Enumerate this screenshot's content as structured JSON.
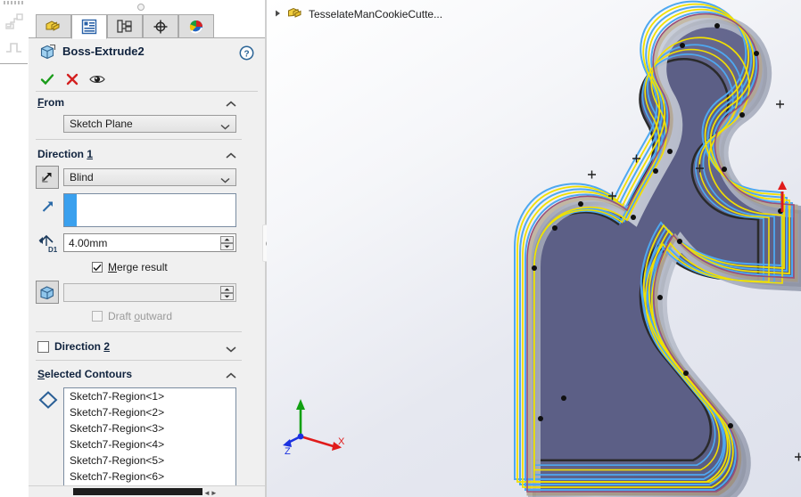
{
  "app": {
    "document_tab": "TesselateManCookieCutte...",
    "doc_icon": "part-document-icon"
  },
  "tabs": [
    {
      "name": "feature-manager-design-tree",
      "icon": "feature-tree-icon",
      "active": false
    },
    {
      "name": "property-manager",
      "icon": "property-list-icon",
      "active": true
    },
    {
      "name": "configuration-manager",
      "icon": "configuration-icon",
      "active": false
    },
    {
      "name": "dimxpert-manager",
      "icon": "dimxpert-target-icon",
      "active": false
    },
    {
      "name": "display-manager",
      "icon": "display-appearance-icon",
      "active": false
    }
  ],
  "property_manager": {
    "title": "Boss-Extrude2",
    "title_icon": "boss-extrude-icon",
    "help_label": "?",
    "actions": [
      {
        "name": "ok-button",
        "icon": "green-check-icon",
        "label": "✔"
      },
      {
        "name": "cancel-button",
        "icon": "red-x-icon",
        "label": "✖"
      },
      {
        "name": "detailed-preview-button",
        "icon": "eye-icon",
        "label": "◉"
      }
    ],
    "sections": {
      "from": {
        "header": "From",
        "header_mnemonic": "F",
        "start_condition": "Sketch Plane"
      },
      "direction1": {
        "header": "Direction ",
        "header_mnemonic": "1",
        "reverse_direction_icon": "reverse-direction-icon",
        "end_condition": "Blind",
        "direction_reference_icon": "direction-arrow-icon",
        "direction_reference_value": "",
        "depth_icon": "depth-dimension-icon",
        "depth_value": "4.00mm",
        "merge_result_label": "Merge result",
        "merge_result_mnemonic": "M",
        "merge_result_checked": true,
        "draft_icon": "draft-angle-icon",
        "draft_value": "",
        "draft_enabled": false,
        "draft_outward_label": "Draft outward",
        "draft_outward_mnemonic": "o",
        "draft_outward_checked": false
      },
      "direction2": {
        "header": "Direction ",
        "header_mnemonic": "2",
        "enabled": false,
        "expanded": false
      },
      "selected_contours": {
        "header": "Selected Contours",
        "header_mnemonic": "S",
        "icon": "contour-diamond-icon",
        "items": [
          "Sketch7-Region<1>",
          "Sketch7-Region<2>",
          "Sketch7-Region<3>",
          "Sketch7-Region<4>",
          "Sketch7-Region<5>",
          "Sketch7-Region<6>"
        ]
      }
    }
  },
  "viewport": {
    "triad": {
      "x_label": "X",
      "y_label": "Y",
      "z_label": "Z",
      "x_color": "#e01b1b",
      "y_color": "#12a012",
      "z_color": "#1b31e0"
    },
    "colors": {
      "body_fill": "#61638c",
      "wall_light": "#c6cbd6",
      "wall_mid": "#9aa0b0",
      "sketch_blue": "#4ea8f0",
      "sketch_yellow": "#f2e000",
      "edge_dark": "#2a2a2a",
      "background_top": "#ffffff",
      "background_bottom": "#dee1ec"
    }
  }
}
